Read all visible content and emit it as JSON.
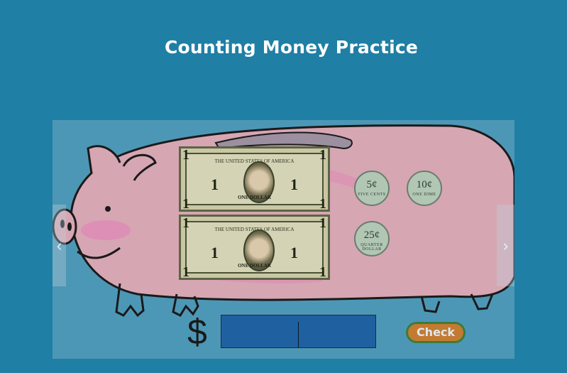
{
  "page": {
    "title": "Counting Money Practice"
  },
  "bills": [
    {
      "banner": "THE UNITED STATES OF AMERICA",
      "value": "1",
      "label": "ONE DOLLAR"
    },
    {
      "banner": "THE UNITED STATES OF AMERICA",
      "value": "1",
      "label": "ONE DOLLAR"
    }
  ],
  "coins": [
    {
      "value": "5¢",
      "label": "FIVE CENTS"
    },
    {
      "value": "10¢",
      "label": "ONE DIME"
    },
    {
      "value": "25¢",
      "label": "QUARTER DOLLAR"
    }
  ],
  "nav": {
    "prev_icon": "chevron-left-icon",
    "next_icon": "chevron-right-icon",
    "prev_glyph": "‹",
    "next_glyph": "›"
  },
  "answer": {
    "currency_symbol": "$",
    "value": ""
  },
  "check": {
    "label": "Check"
  },
  "colors": {
    "background": "#1f7fa5",
    "pig": "#d6a6b3",
    "check_button": "#c27b30",
    "answer_box": "#1f60a0"
  }
}
